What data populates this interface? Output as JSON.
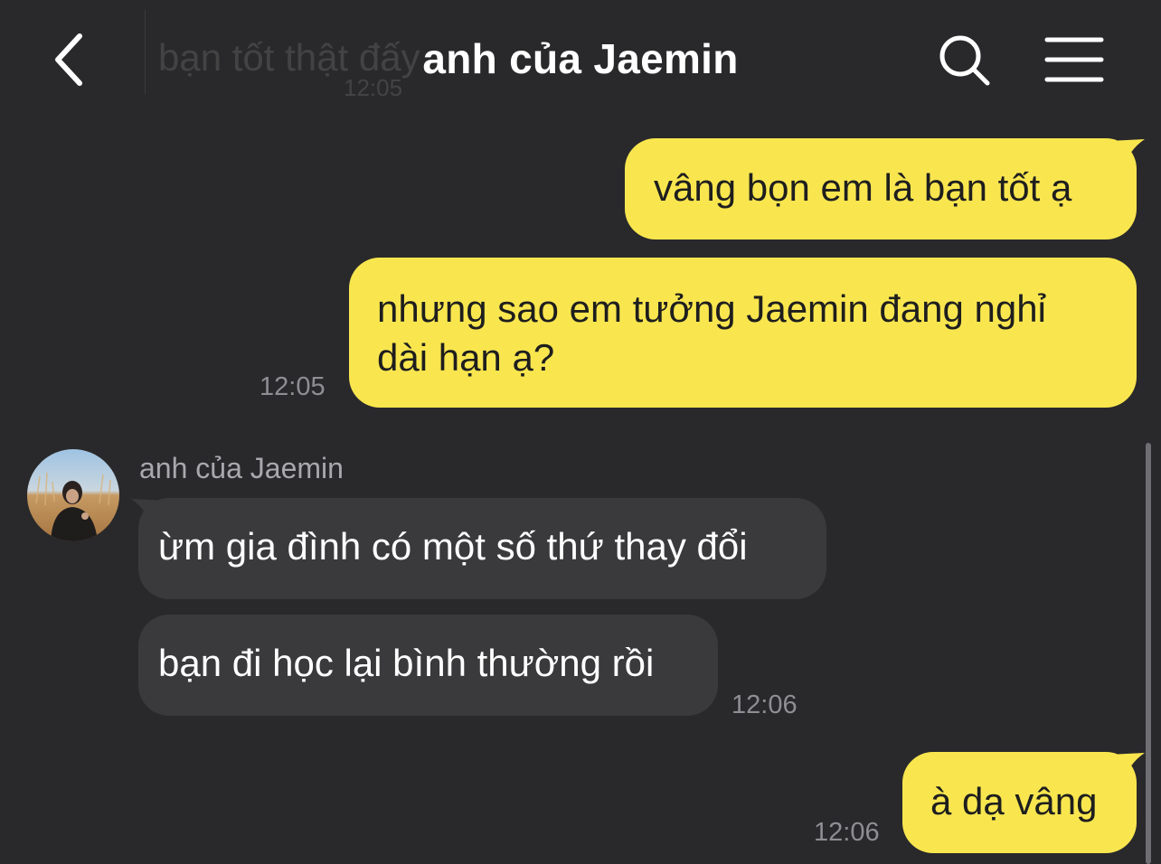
{
  "header": {
    "title": "anh của Jaemin",
    "ghost_message": "bạn tốt thật đấy",
    "ghost_time": "12:05",
    "back_icon": "chevron-left-icon",
    "search_icon": "search-icon",
    "menu_icon": "hamburger-menu-icon"
  },
  "messages": [
    {
      "from": "me",
      "text": "vâng bọn em là bạn tốt ạ"
    },
    {
      "from": "me",
      "line1": "nhưng sao em tưởng Jaemin đang nghỉ",
      "line2": "dài hạn ạ?",
      "time": "12:05"
    },
    {
      "from": "other",
      "sender": "anh của Jaemin",
      "text": "ừm gia đình có một số thứ thay đổi"
    },
    {
      "from": "other",
      "text": "bạn đi học lại bình thường rồi",
      "time": "12:06"
    },
    {
      "from": "me",
      "text": "à dạ vâng",
      "time": "12:06"
    }
  ],
  "colors": {
    "background": "#29292b",
    "my_bubble": "#f9e64f",
    "other_bubble": "#3a3a3c",
    "timestamp": "#8e8e93"
  }
}
